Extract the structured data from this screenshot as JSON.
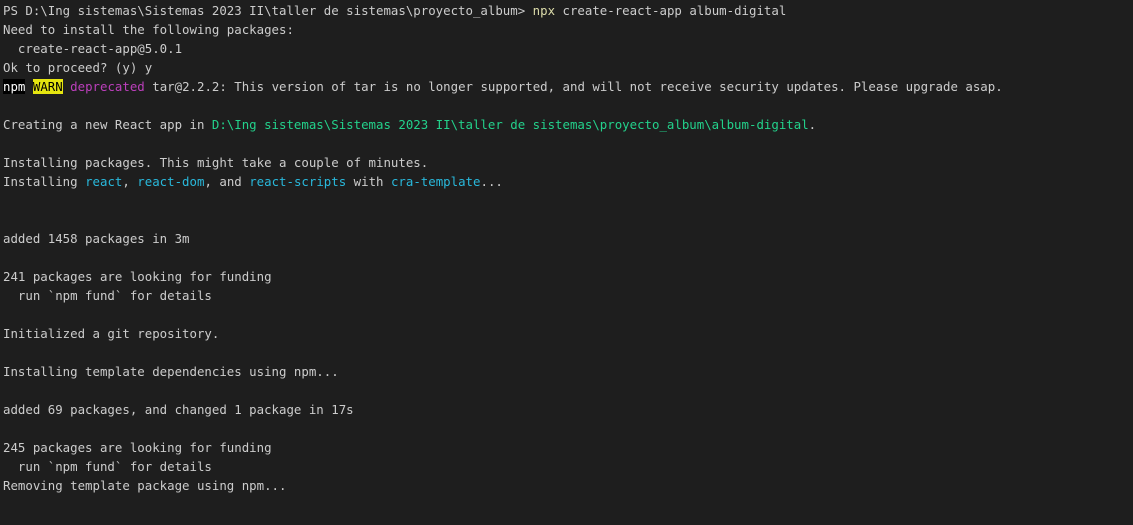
{
  "terminal": {
    "prompt": "PS D:\\Ing sistemas\\Sistemas 2023 II\\taller de sistemas\\proyecto_album> ",
    "command": "npx",
    "command_args": " create-react-app album-digital",
    "line_need_install": "Need to install the following packages:",
    "line_package": "  create-react-app@5.0.1",
    "line_proceed": "Ok to proceed? (y) y",
    "warn": {
      "npm": "npm",
      "label": "WARN",
      "kind": "deprecated",
      "message": " tar@2.2.2: This version of tar is no longer supported, and will not receive security updates. Please upgrade asap."
    },
    "creating": {
      "prefix": "Creating a new React app in ",
      "path": "D:\\Ing sistemas\\Sistemas 2023 II\\taller de sistemas\\proyecto_album\\album-digital",
      "suffix": "."
    },
    "line_installing_packages": "Installing packages. This might take a couple of minutes.",
    "installing": {
      "prefix": "Installing ",
      "pkg1": "react",
      "sep1": ", ",
      "pkg2": "react-dom",
      "sep2": ", and ",
      "pkg3": "react-scripts",
      "sep3": " with ",
      "template": "cra-template",
      "suffix": "..."
    },
    "line_added_1458": "added 1458 packages in 3m",
    "line_funding_241": "241 packages are looking for funding",
    "line_fund_details_1": "  run `npm fund` for details",
    "line_git": "Initialized a git repository.",
    "line_template_deps": "Installing template dependencies using npm...",
    "line_added_69": "added 69 packages, and changed 1 package in 17s",
    "line_funding_245": "245 packages are looking for funding",
    "line_fund_details_2": "  run `npm fund` for details",
    "line_removing": "Removing template package using npm..."
  },
  "colors": {
    "background": "#1e1e1e",
    "text": "#cccccc",
    "command": "#dcdcaa",
    "warn_bg": "#e5e510",
    "deprecated": "#bc3fbc",
    "path": "#23d18b",
    "package": "#29b8db"
  }
}
